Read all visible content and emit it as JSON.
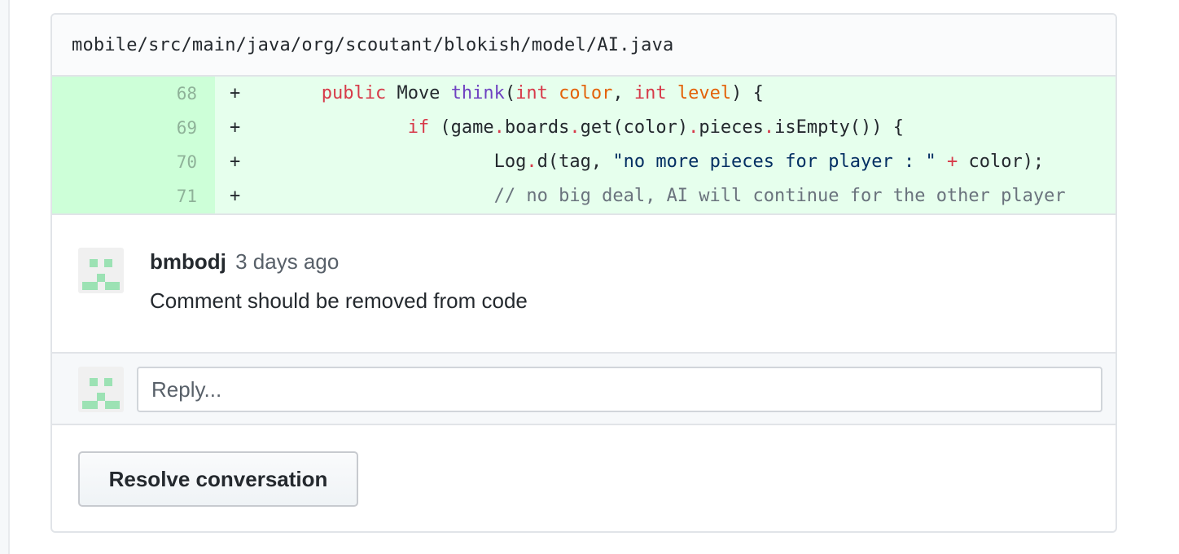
{
  "file": {
    "path": "mobile/src/main/java/org/scoutant/blokish/model/AI.java"
  },
  "diff": {
    "lines": [
      {
        "num": "68",
        "marker": "+"
      },
      {
        "num": "69",
        "marker": "+"
      },
      {
        "num": "70",
        "marker": "+"
      },
      {
        "num": "71",
        "marker": "+"
      }
    ],
    "tokens": {
      "l68": [
        "public",
        " Move ",
        "think",
        "(",
        "int",
        " ",
        "color",
        ", ",
        "int",
        " ",
        "level",
        ") {"
      ],
      "l69": [
        "if",
        " (game",
        ".",
        "boards",
        ".",
        "get(color)",
        ".",
        "pieces",
        ".",
        "isEmpty()) {"
      ],
      "l70": [
        "Log",
        ".",
        "d(tag, ",
        "\"no more pieces for player : \"",
        " ",
        "+",
        " color);"
      ],
      "l71": [
        "// no big deal, AI will continue for the other player"
      ]
    }
  },
  "comment": {
    "author": "bmbodj",
    "time": "3 days ago",
    "body": "Comment should be removed from code"
  },
  "reply": {
    "placeholder": "Reply..."
  },
  "actions": {
    "resolve_label": "Resolve conversation"
  },
  "colors": {
    "addition_bg": "#e6ffed",
    "addition_num_bg": "#cdffd8",
    "keyword": "#d73a49",
    "function": "#6f42c1",
    "param": "#e36209",
    "string": "#032f62"
  },
  "icons": {
    "avatar": "identicon-avatar"
  }
}
